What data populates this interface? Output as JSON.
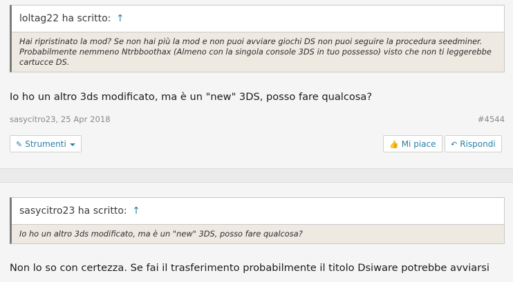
{
  "posts": [
    {
      "quote_author": "loltag22 ha scritto:",
      "quote_arrow": "↑",
      "quote_text": "Hai ripristinato la mod? Se non hai più la mod e non puoi avviare giochi DS non puoi seguire la procedura seedminer. Probabilmente nemmeno Ntrbboothax (Almeno con la singola console 3DS in tuo possesso) visto che non ti leggerebbe cartucce DS.",
      "message": "Io ho un altro 3ds modificato, ma è un \"new\" 3DS, posso fare qualcosa?",
      "author_date": "sasycitro23, 25 Apr 2018",
      "post_number": "#4544",
      "tools_label": "Strumenti",
      "like_label": "Mi piace",
      "reply_label": "Rispondi"
    },
    {
      "quote_author": "sasycitro23 ha scritto:",
      "quote_arrow": "↑",
      "quote_text": "Io ho un altro 3ds modificato, ma è un \"new\" 3DS, posso fare qualcosa?",
      "message": "Non lo so con certezza. Se fai il trasferimento probabilmente il titolo Dsiware potrebbe avviarsi"
    }
  ],
  "icons": {
    "tools": "pencil-icon",
    "like": "thumbs-up-icon",
    "reply": "reply-icon",
    "quote_link": "up-arrow-icon"
  },
  "colors": {
    "link": "#2a7fa8",
    "quote_bg": "#eeeae2",
    "page_bg": "#f5f5f5"
  }
}
